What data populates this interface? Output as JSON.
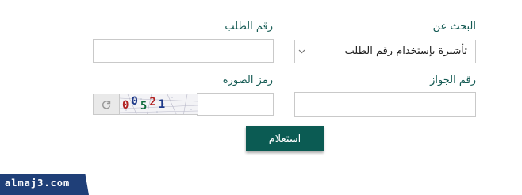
{
  "form": {
    "search_by_label": "البحث عن",
    "search_by_value": "تأشيرة بإستخدام رقم الطلب",
    "request_number_label": "رقم الطلب",
    "request_number_value": "",
    "passport_number_label": "رقم الجواز",
    "passport_number_value": "",
    "captcha_label": "رمز الصورة",
    "captcha_value": "",
    "captcha_code": "00521",
    "submit_label": "استعلام"
  },
  "icons": {
    "refresh": "refresh-icon",
    "dropdown": "chevron-down-icon"
  },
  "colors": {
    "accent": "#0b5b53",
    "label": "#145a53",
    "watermark_bg": "#1f3f78"
  },
  "watermark": {
    "text": "almaj3.com"
  }
}
